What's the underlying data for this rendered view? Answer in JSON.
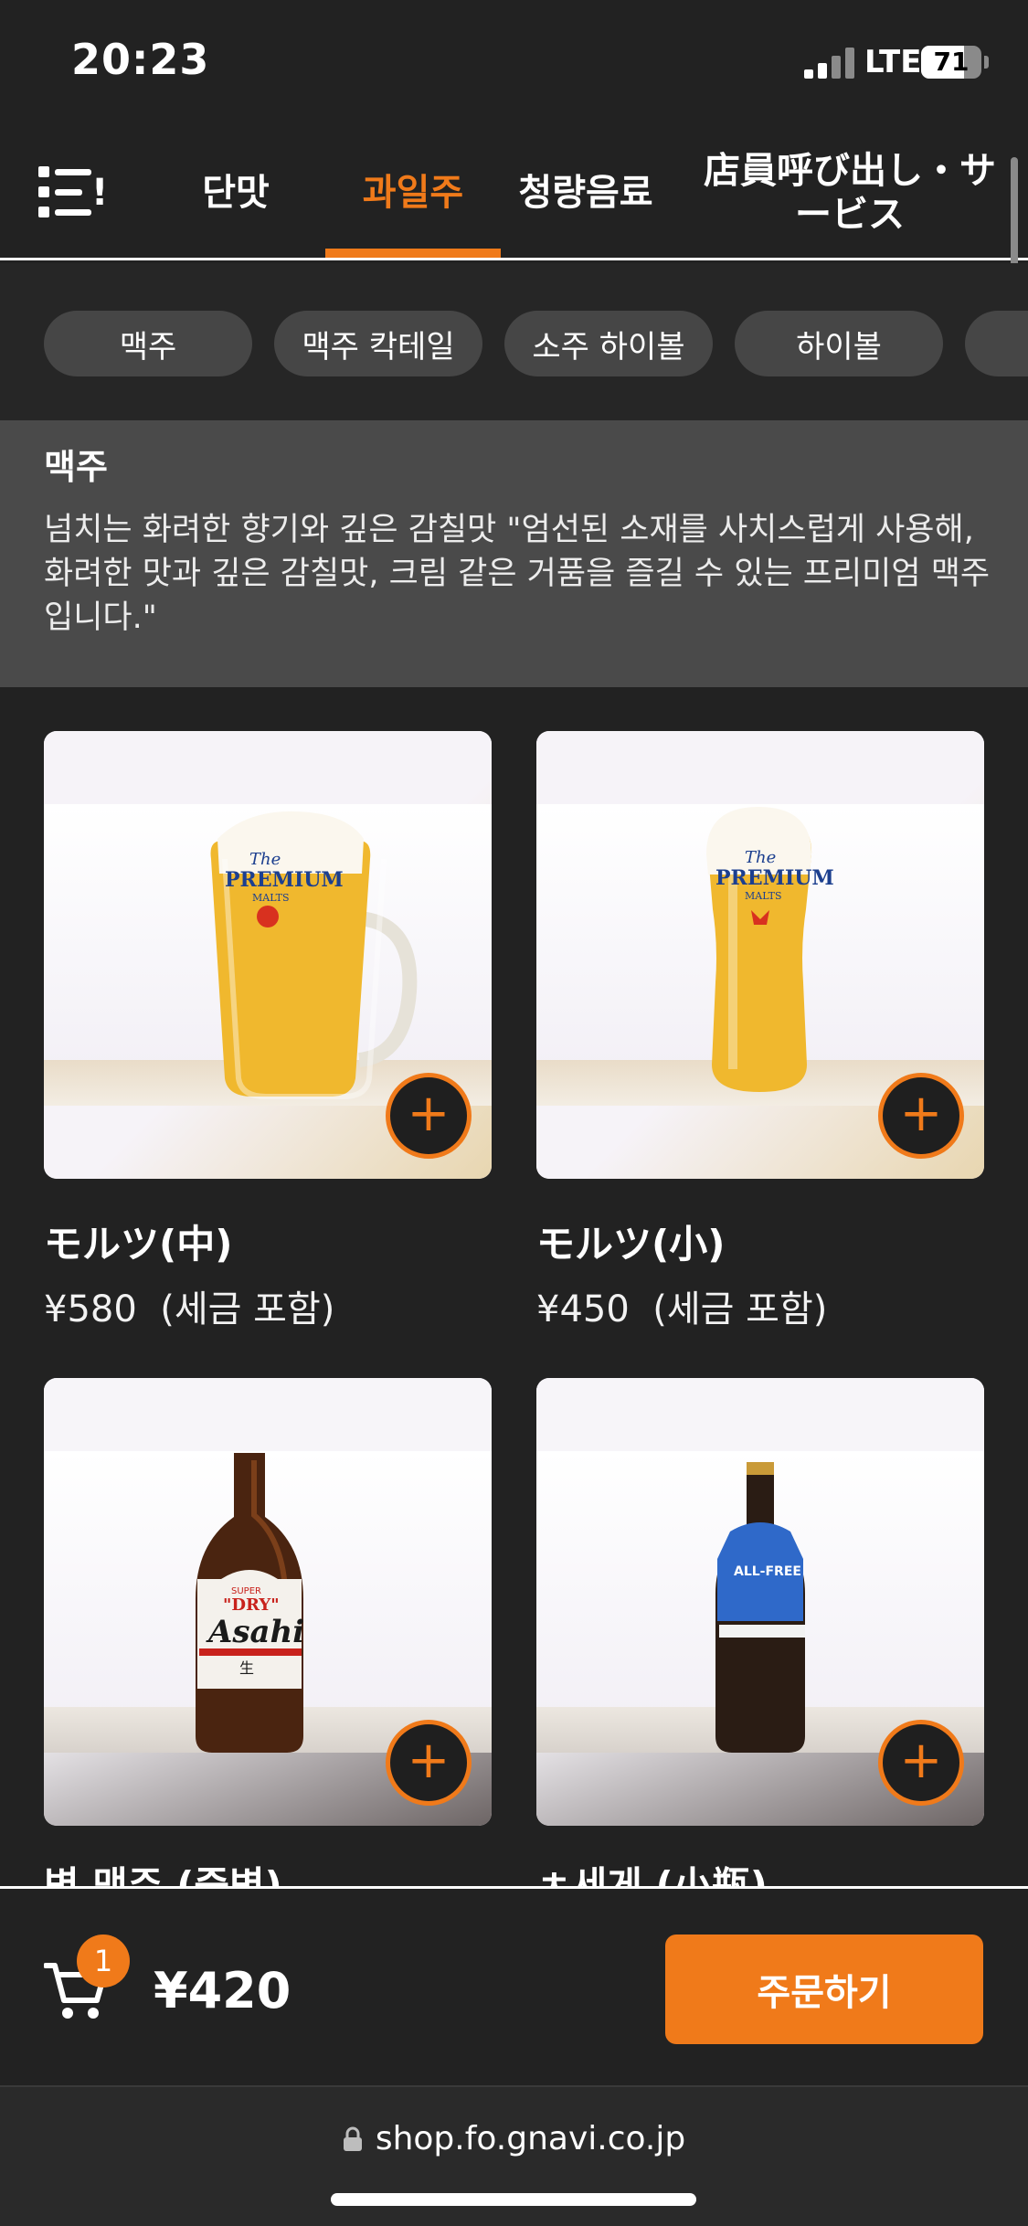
{
  "status_bar": {
    "time": "20:23",
    "network": "LTE",
    "battery": "71",
    "battery_level": 0.71
  },
  "tabs": [
    {
      "label": "!",
      "partial": true
    },
    {
      "label": "단맛"
    },
    {
      "label": "과일주",
      "active": true
    },
    {
      "label": "청량음료"
    },
    {
      "label": "店員呼び出し・サービス"
    }
  ],
  "subcategories": [
    "맥주",
    "맥주 칵테일",
    "소주 하이볼",
    "하이볼",
    ""
  ],
  "section": {
    "title": "맥주",
    "description": "넘치는 화려한 향기와 깊은 감칠맛 \"엄선된 소재를 사치스럽게 사용해, 화려한 맛과 깊은 감칠맛, 크림 같은 거품을 즐길 수 있는 프리미엄 맥주입니다.\""
  },
  "products": [
    {
      "name": "モルツ(中)",
      "price": "¥580",
      "tax_note": "(세금 포함)",
      "photo": "beer-mug-premium-malts"
    },
    {
      "name": "モルツ(小)",
      "price": "¥450",
      "tax_note": "(세금 포함)",
      "photo": "beer-glass-premium-malts"
    },
    {
      "name": "병 맥주 (중병)",
      "price": "",
      "tax_note": "",
      "photo": "asahi-super-dry-bottle"
    },
    {
      "name": "ㅊ세게 (小瓶)",
      "price": "",
      "tax_note": "",
      "photo": "all-free-bottle"
    }
  ],
  "product_labels": {
    "premium_brand": "The",
    "premium_name": "PREMIUM",
    "premium_sub": "MALTS",
    "asahi_super": "SUPER",
    "asahi_dry": "\"DRY\"",
    "asahi_name": "Asahi",
    "asahi_nama": "生",
    "allfree": "ALL-FREE"
  },
  "add_button_symbol": "+",
  "cart": {
    "count": "1",
    "total": "¥420",
    "order_label": "주문하기"
  },
  "browser": {
    "url": "shop.fo.gnavi.co.jp"
  },
  "colors": {
    "accent": "#f07a1a",
    "background": "#222222",
    "section_bg": "#4a4a4a",
    "chip_bg": "#464646"
  }
}
